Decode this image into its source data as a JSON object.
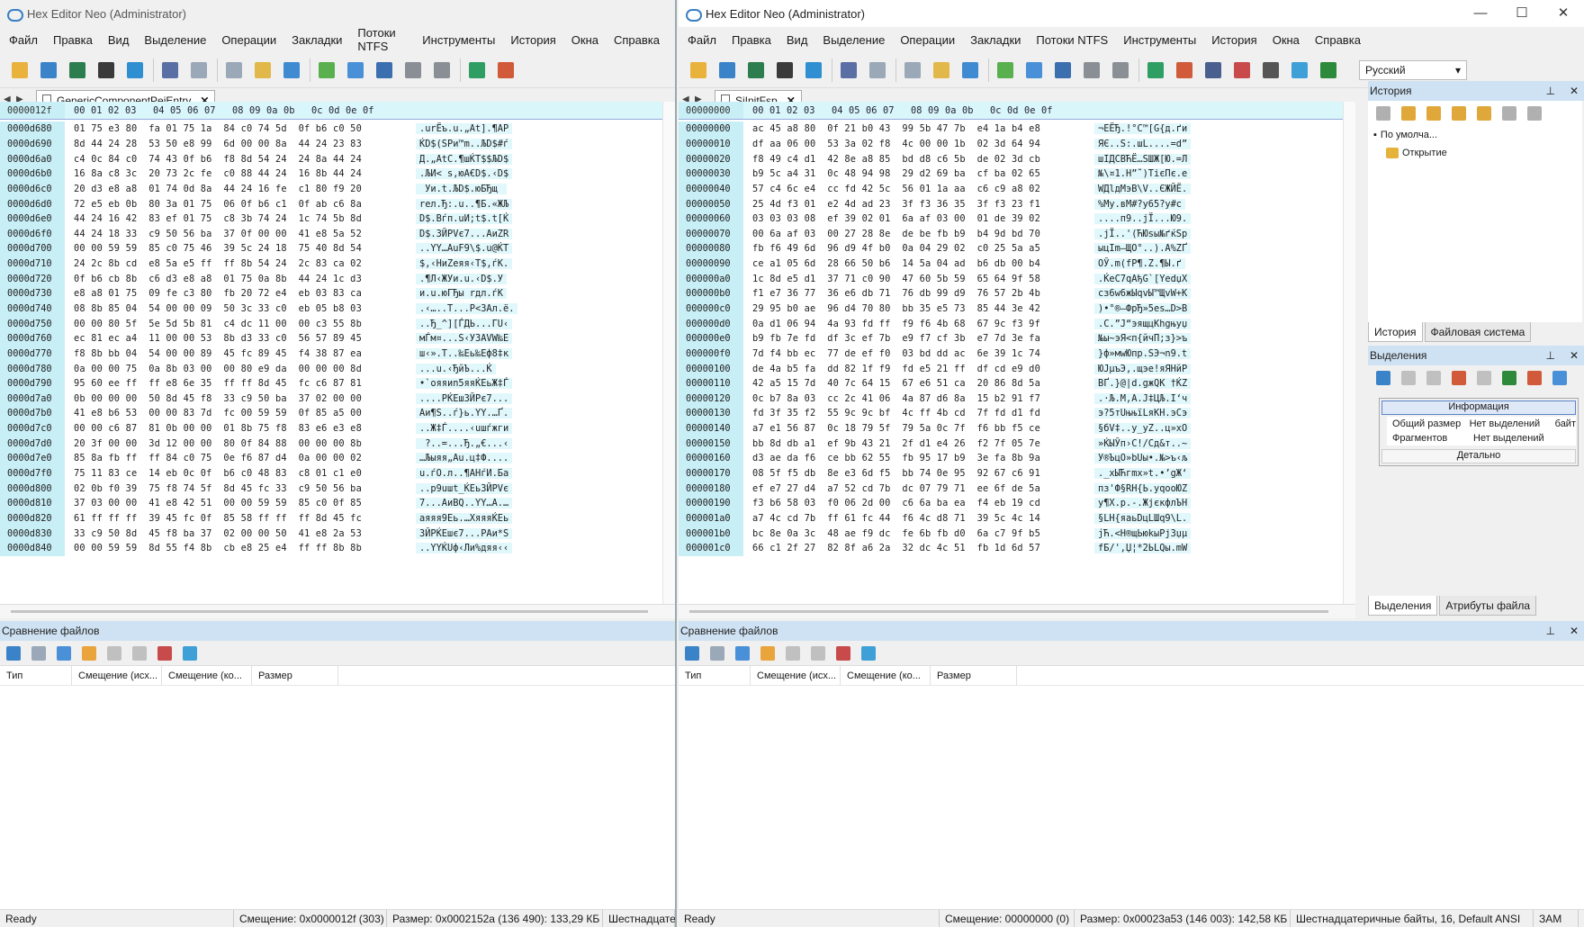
{
  "left": {
    "title": "Hex Editor Neo (Administrator)",
    "menu": [
      "Файл",
      "Правка",
      "Вид",
      "Выделение",
      "Операции",
      "Закладки",
      "Потоки NTFS",
      "Инструменты",
      "История",
      "Окна",
      "Справка"
    ],
    "tab": "GenericComponentPeiEntry",
    "offset_header": "0000012f",
    "hex_header": [
      "00",
      "01",
      "02",
      "03",
      "04",
      "05",
      "06",
      "07",
      "08",
      "09",
      "0a",
      "0b",
      "0c",
      "0d",
      "0e",
      "0f"
    ],
    "rows": [
      [
        "0000d680",
        "01 75 e3 80  fa 01 75 1a  84 c0 74 5d  0f b6 c0 50",
        ".urЁъ.u.„At].¶АР"
      ],
      [
        "0000d690",
        "8d 44 24 28  53 50 e8 99  6d 00 00 8a  44 24 23 83",
        "ЌD$(SPи™m..ЉD$#ѓ"
      ],
      [
        "0000d6a0",
        "c4 0c 84 c0  74 43 0f b6  f8 8d 54 24  24 8a 44 24",
        "Д.„АtC.¶шЌT$$ЉD$"
      ],
      [
        "0000d6b0",
        "16 8a c8 3c  20 73 2c fe  c0 88 44 24  16 8b 44 24",
        ".ЉИ< s,юА€D$.‹D$"
      ],
      [
        "0000d6c0",
        "20 d3 e8 a8  01 74 0d 8a  44 24 16 fe  c1 80 f9 20",
        " Уи.t.ЉD$.юБЂщ "
      ],
      [
        "0000d6d0",
        "72 e5 eb 0b  80 3a 01 75  06 0f b6 c1  0f ab c6 8a",
        "rел.Ђ:.u..¶Б.«ЖЉ"
      ],
      [
        "0000d6e0",
        "44 24 16 42  83 ef 01 75  c8 3b 74 24  1c 74 5b 8d",
        "D$.Bѓп.uИ;t$.t[Ќ"
      ],
      [
        "0000d6f0",
        "44 24 18 33  c9 50 56 ba  37 0f 00 00  41 e8 5a 52",
        "D$.3ЙPVє7...AиZR"
      ],
      [
        "0000d700",
        "00 00 59 59  85 c0 75 46  39 5c 24 18  75 40 8d 54",
        "..YY…АuF9\\$.u@ЌT"
      ],
      [
        "0000d710",
        "24 2c 8b cd  e8 5a e5 ff  ff 8b 54 24  2c 83 ca 02",
        "$,‹НиZеяя‹T$,ѓК."
      ],
      [
        "0000d720",
        "0f b6 cb 8b  c6 d3 e8 a8  01 75 0a 8b  44 24 1c d3",
        ".¶Л‹ЖУи.u.‹D$.У"
      ],
      [
        "0000d730",
        "e8 a8 01 75  09 fe c3 80  fb 20 72 e4  eb 03 83 ca",
        "и.u.юГЂы rдл.ѓК"
      ],
      [
        "0000d740",
        "08 8b 85 04  54 00 00 09  50 3c 33 c0  eb 05 b8 03",
        ".‹…..T...P<3Ал.ё."
      ],
      [
        "0000d750",
        "00 00 80 5f  5e 5d 5b 81  c4 dc 11 00  00 c3 55 8b",
        "..Ђ_^][ЃДЬ...ГU‹"
      ],
      [
        "0000d760",
        "ec 81 ec a4  11 00 00 53  8b d3 33 c0  56 57 89 45",
        "мЃм¤...S‹У3АVW‰E"
      ],
      [
        "0000d770",
        "f8 8b bb 04  54 00 00 89  45 fc 89 45  f4 38 87 ea",
        "ш‹».T..‰Eь‰Eф8‡к"
      ],
      [
        "0000d780",
        "0a 00 00 75  0a 8b 03 00  00 80 e9 da  00 00 00 8d",
        "...u.‹ЂйЪ...Ќ"
      ],
      [
        "0000d790",
        "95 60 ee ff  ff e8 6e 35  ff ff 8d 45  fc c6 87 81",
        "•`ояяиn5яяЌEьЖ‡Ѓ"
      ],
      [
        "0000d7a0",
        "0b 00 00 00  50 8d 45 f8  33 c9 50 ba  37 02 00 00",
        "....PЌEш3ЙPє7..."
      ],
      [
        "0000d7b0",
        "41 e8 b6 53  00 00 83 7d  fc 00 59 59  0f 85 a5 00",
        "Aи¶S..ѓ}ь.YY.…Ґ."
      ],
      [
        "0000d7c0",
        "00 00 c6 87  81 0b 00 00  01 8b 75 f8  83 e6 e3 e8",
        "..Ж‡Ѓ....‹uшѓжги"
      ],
      [
        "0000d7d0",
        "20 3f 00 00  3d 12 00 00  80 0f 84 88  00 00 00 8b",
        " ?..=...Ђ.„€...‹"
      ],
      [
        "0000d7e0",
        "85 8a fb ff  ff 84 c0 75  0e f6 87 d4  0a 00 00 02",
        "…Љыяя„Аu.ц‡Ф...."
      ],
      [
        "0000d7f0",
        "75 11 83 ce  14 eb 0c 0f  b6 c0 48 83  c8 01 c1 e0",
        "u.ѓО.л..¶АHѓИ.Ба"
      ],
      [
        "0000d800",
        "02 0b f0 39  75 f8 74 5f  8d 45 fc 33  c9 50 56 ba",
        "..р9uшt_ЌEь3ЙPVє"
      ],
      [
        "0000d810",
        "37 03 00 00  41 e8 42 51  00 00 59 59  85 c0 0f 85",
        "7...AиBQ..YY…А.…"
      ],
      [
        "0000d820",
        "61 ff ff ff  39 45 fc 0f  85 58 ff ff  ff 8d 45 fc",
        "aяяя9Eь.…XяяяЌEь"
      ],
      [
        "0000d830",
        "33 c9 50 8d  45 f8 ba 37  02 00 00 50  41 e8 2a 53",
        "3ЙPЌEшє7...PAи*S"
      ],
      [
        "0000d840",
        "00 00 59 59  8d 55 f4 8b  cb e8 25 e4  ff ff 8b 8b",
        "..YYЌUф‹Ли%дяя‹‹"
      ]
    ],
    "status": [
      "Ready",
      "Смещение: 0x0000012f (303)",
      "Размер: 0x0002152a (136 490): 133,29 КБ",
      "Шестнадцатер"
    ]
  },
  "right": {
    "title": "Hex Editor Neo (Administrator)",
    "menu": [
      "Файл",
      "Правка",
      "Вид",
      "Выделение",
      "Операции",
      "Закладки",
      "Потоки NTFS",
      "Инструменты",
      "История",
      "Окна",
      "Справка"
    ],
    "lang": "Русский",
    "tab": "SiInitFsp",
    "offset_header": "00000000",
    "hex_header": [
      "00",
      "01",
      "02",
      "03",
      "04",
      "05",
      "06",
      "07",
      "08",
      "09",
      "0a",
      "0b",
      "0c",
      "0d",
      "0e",
      "0f"
    ],
    "rows": [
      [
        "00000000",
        "ac 45 a8 80  0f 21 b0 43  99 5b 47 7b  e4 1a b4 e8",
        "¬EЁЂ.!°C™[G{д.ґи"
      ],
      [
        "00000010",
        "df aa 06 00  53 3a 02 f8  4c 00 00 1b  02 3d 64 94",
        "ЯЄ..S:.шL....=d”"
      ],
      [
        "00000020",
        "f8 49 c4 d1  42 8e a8 85  bd d8 c6 5b  de 02 3d cb",
        "шIДСBЋЁ…ЅШЖ[Ю.=Л"
      ],
      [
        "00000030",
        "b9 5c a4 31  0c 48 94 98  29 d2 69 ba  cf ba 02 65",
        "№\\¤1.H”˜)ТiєПє.e"
      ],
      [
        "00000040",
        "57 c4 6c e4  cc fd 42 5c  56 01 1a aa  c6 c9 a8 02",
        "WДlдМэB\\V..ЄЖЙЁ."
      ],
      [
        "00000050",
        "25 4d f3 01  e2 4d ad 23  3f f3 36 35  3f f3 23 f1",
        "%Mу.вM­#?у65?у#с"
      ],
      [
        "00000060",
        "03 03 03 08  ef 39 02 01  6a af 03 00  01 de 39 02",
        "....п9..jЇ...Ю9."
      ],
      [
        "00000070",
        "00 6a af 03  00 27 28 8e  de be fb b9  b4 9d bd 70",
        ".jЇ..'(ЋЮѕы№ґќЅp"
      ],
      [
        "00000080",
        "fb f6 49 6d  96 d9 4f b0  0a 04 29 02  c0 25 5a a5",
        "ыцIm–ЩO°..).А%ZҐ"
      ],
      [
        "00000090",
        "ce a1 05 6d  28 66 50 b6  14 5a 04 ad  b6 db 00 b4",
        "ОЎ.m(fP¶.Z.­¶Ы.ґ"
      ],
      [
        "000000a0",
        "1c 8d e5 d1  37 71 c0 90  47 60 5b 59  65 64 9f 58",
        ".ЌеС7qАђG`[YedџX"
      ],
      [
        "000000b0",
        "f1 e7 36 77  36 e6 db 71  76 db 99 d9  76 57 2b 4b",
        "сз6w6жЫqvЫ™ЩvW+K"
      ],
      [
        "000000c0",
        "29 95 b0 ae  96 d4 70 80  bb 35 e5 73  85 44 3e 42",
        ")•°®–ФpЂ»5еs…D>B"
      ],
      [
        "000000d0",
        "0a d1 06 94  4a 93 fd ff  f9 f6 4b 68  67 9c f3 9f",
        ".С.”J“эящцKhgњуџ"
      ],
      [
        "000000e0",
        "b9 fb 7e fd  df 3c ef 7b  e9 f7 cf 3b  e7 7d 3e fa",
        "№ы~эЯ<п{йчП;з}>ъ"
      ],
      [
        "000000f0",
        "7d f4 bb ec  77 de ef f0  03 bd dd ac  6e 39 1c 74",
        "}ф»мwЮпр.ЅЭ¬n9.t"
      ],
      [
        "00000100",
        "de 4a b5 fa  dd 82 1f f9  fd e5 21 ff  df cd e9 d0",
        "ЮJµъЭ‚.щэе!яЯНйР"
      ],
      [
        "00000110",
        "42 a5 15 7d  40 7c 64 15  67 e6 51 ca  20 86 8d 5a",
        "BҐ.}@|d.gжQК †ЌZ"
      ],
      [
        "00000120",
        "0c b7 8a 03  cc 2c 41 06  4a 87 d6 8a  15 b2 91 f7",
        ".·Љ.М,A.J‡ЦЉ.І‘ч"
      ],
      [
        "00000130",
        "fd 3f 35 f2  55 9c 9c bf  4c ff 4b cd  7f fd d1 fd",
        "э?5тUњњїLяKН.эСэ"
      ],
      [
        "00000140",
        "a7 e1 56 87  0c 18 79 5f  79 5a 0c 7f  f6 bb f5 ce",
        "§бV‡..y_yZ..ц»хО"
      ],
      [
        "00000150",
        "bb 8d db a1  ef 9b 43 21  2f d1 e4 26  f2 7f 05 7e",
        "»ЌЫЎп›C!/Сд&т..~"
      ],
      [
        "00000160",
        "d3 ae da f6  ce bb 62 55  fb 95 17 b9  3e fa 8b 9a",
        "У®ЪцО»bUы•.№>ъ‹љ"
      ],
      [
        "00000170",
        "08 5f f5 db  8e e3 6d f5  bb 74 0e 95  92 67 c6 91",
        "._хЫЋгmх»t.•’gЖ‘"
      ],
      [
        "00000180",
        "ef e7 27 d4  a7 52 cd 7b  dc 07 79 71  ee 6f de 5a",
        "пз'Ф§RН{Ь.yqoоЮZ"
      ],
      [
        "00000190",
        "f3 b6 58 03  f0 06 2d 00  c6 6a ba ea  f4 eb 19 cd",
        "у¶X.р.-.ЖjєкфлЪН"
      ],
      [
        "000001a0",
        "a7 4c cd 7b  ff 61 fc 44  f6 4c d8 71  39 5c 4c 14",
        "§LН{яaьDцLШq9\\L."
      ],
      [
        "000001b0",
        "bc 8e 0a 3c  48 ae f9 dc  fe 6b fb d0  6a c7 9f b5",
        "јЋ.<H®щЬюkыРjЗџµ"
      ],
      [
        "000001c0",
        "66 c1 2f 27  82 8f a6 2a  32 dc 4c 51  fb 1d 6d 57",
        "fБ/'‚Џ¦*2ЬLQы.mW"
      ]
    ],
    "status": [
      "Ready",
      "Смещение: 00000000 (0)",
      "Размер: 0x00023a53 (146 003): 142,58 КБ",
      "Шестнадцатеричные байты, 16, Default ANSI",
      "ЗАМ"
    ]
  },
  "compare": {
    "title": "Сравнение файлов",
    "columns": [
      "Тип",
      "Смещение (исх...",
      "Смещение (ко...",
      "Размер"
    ]
  },
  "side": {
    "history_title": "История",
    "history_root": "По умолча...",
    "history_item": "Открытие",
    "tabs": [
      "История",
      "Файловая система"
    ],
    "selection_title": "Выделения",
    "info_header": "Информация",
    "info_rows": [
      [
        "Общий размер",
        "Нет выделений",
        "байт"
      ],
      [
        "Фрагментов",
        "Нет выделений",
        ""
      ]
    ],
    "detail": "Детально",
    "bottom_tabs": [
      "Выделения",
      "Атрибуты файла"
    ]
  }
}
